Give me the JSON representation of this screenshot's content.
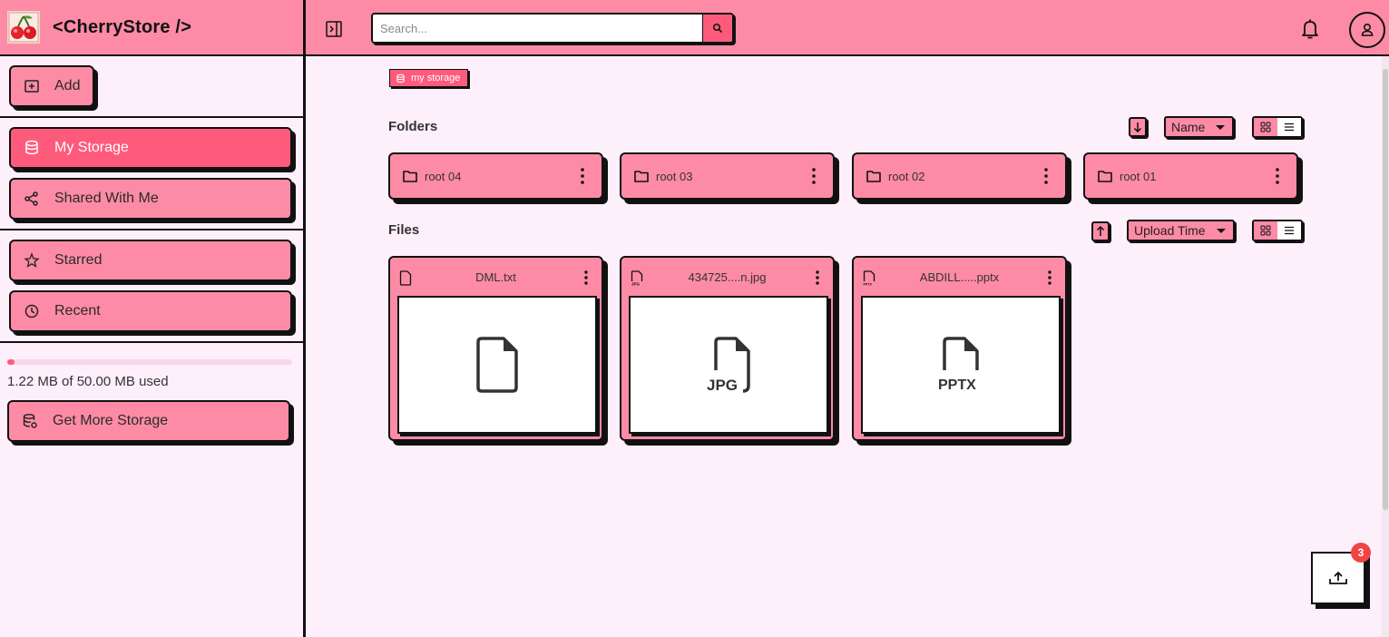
{
  "app": {
    "name": "<CherryStore />"
  },
  "sidebar": {
    "add_label": "Add",
    "nav": [
      {
        "label": "My Storage",
        "icon": "database-icon",
        "active": true
      },
      {
        "label": "Shared With Me",
        "icon": "share-icon",
        "active": false
      }
    ],
    "secondary": [
      {
        "label": "Starred",
        "icon": "star-icon"
      },
      {
        "label": "Recent",
        "icon": "clock-icon"
      }
    ],
    "storage": {
      "used_fraction": 0.0244,
      "used_text": "1.22 MB of 50.00 MB used"
    },
    "get_more_label": "Get More Storage"
  },
  "topbar": {
    "search_placeholder": "Search..."
  },
  "breadcrumb": {
    "label": "my storage"
  },
  "folders": {
    "title": "Folders",
    "sort_label": "Name",
    "sort_direction": "descending",
    "view_mode": "grid",
    "items": [
      {
        "name": "root 04"
      },
      {
        "name": "root 03"
      },
      {
        "name": "root 02"
      },
      {
        "name": "root 01"
      }
    ]
  },
  "files": {
    "title": "Files",
    "sort_label": "Upload Time",
    "sort_direction": "ascending",
    "view_mode": "grid",
    "items": [
      {
        "name": "DML.txt",
        "type": "txt",
        "preview_label": ""
      },
      {
        "name": "434725....n.jpg",
        "type": "jpg",
        "preview_label": "JPG"
      },
      {
        "name": "ABDILL.....pptx",
        "type": "pptx",
        "preview_label": "PPTX"
      }
    ]
  },
  "uploads": {
    "count": "3"
  },
  "colors": {
    "accent": "#fe8ba6",
    "accent_strong": "#fe5b7c",
    "background": "#fdf0fb",
    "badge": "#f04444"
  }
}
